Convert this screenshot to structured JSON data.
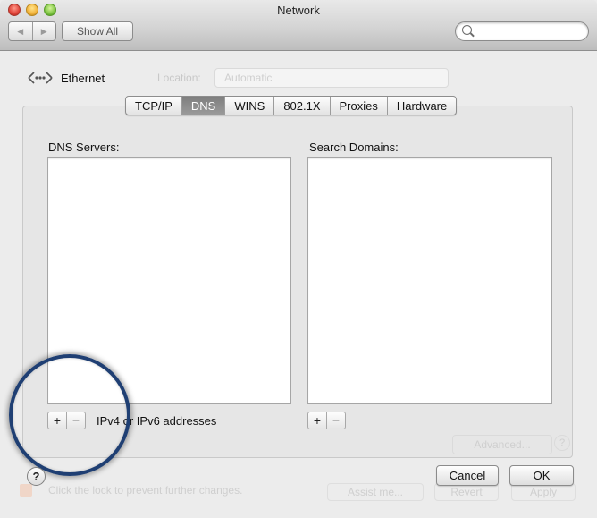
{
  "window": {
    "title": "Network"
  },
  "toolbar": {
    "show_all_label": "Show All",
    "back_glyph": "◀",
    "forward_glyph": "▶",
    "search": {
      "value": "",
      "placeholder": ""
    }
  },
  "header": {
    "interface_label": "Ethernet",
    "location_label": "Location:",
    "location_value": "Automatic"
  },
  "tabs": [
    {
      "label": "TCP/IP",
      "active": false
    },
    {
      "label": "DNS",
      "active": true
    },
    {
      "label": "WINS",
      "active": false
    },
    {
      "label": "802.1X",
      "active": false
    },
    {
      "label": "Proxies",
      "active": false
    },
    {
      "label": "Hardware",
      "active": false
    }
  ],
  "dns": {
    "servers_label": "DNS Servers:",
    "servers": [],
    "search_domains_label": "Search Domains:",
    "search_domains": [],
    "hint": "IPv4 or IPv6 addresses"
  },
  "buttons": {
    "plus": "+",
    "minus": "−",
    "help": "?",
    "cancel": "Cancel",
    "ok": "OK"
  },
  "background_ghosts": {
    "advanced": "Advanced...",
    "help": "?",
    "lock_text": "Click the lock to prevent further changes.",
    "assist": "Assist me...",
    "revert": "Revert",
    "apply": "Apply"
  },
  "colors": {
    "tab_active_bg": "#8a8a8a",
    "ring": "#1f3f73"
  },
  "icons": {
    "ethernet": "ethernet-icon",
    "search": "search-icon"
  }
}
